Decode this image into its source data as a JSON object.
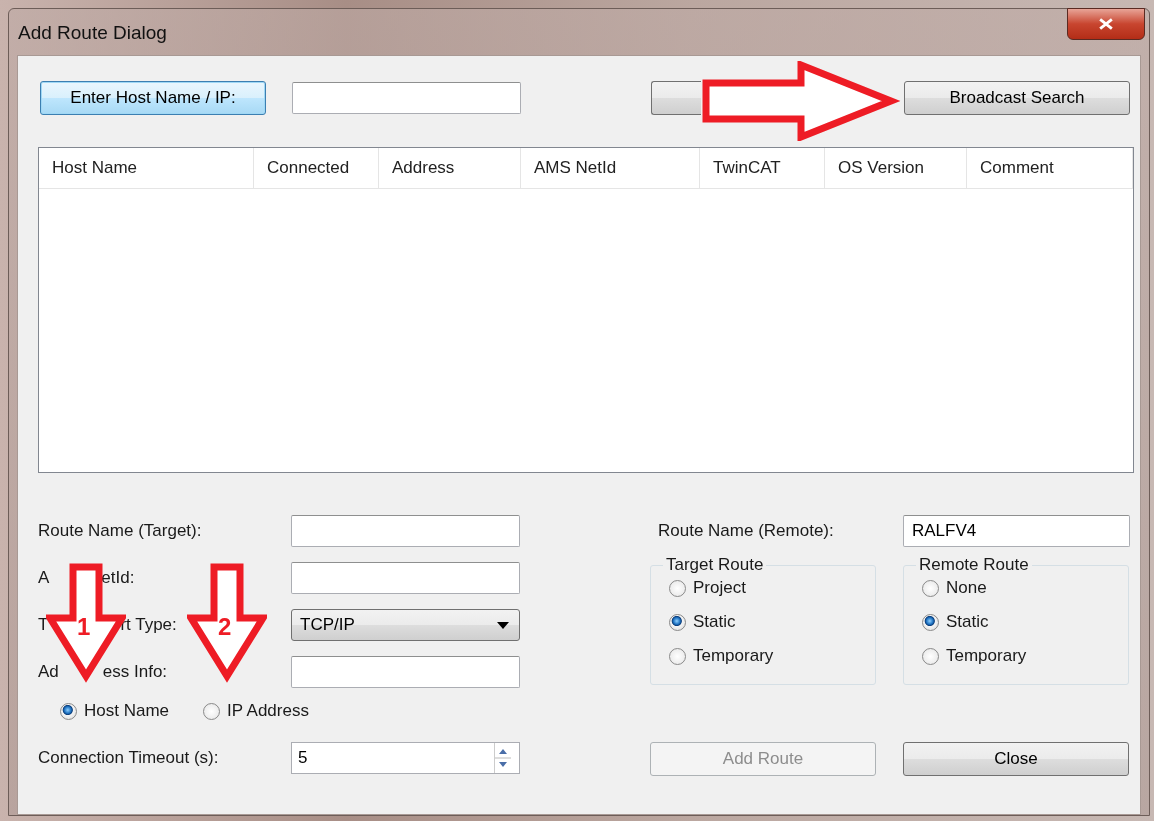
{
  "window": {
    "title": "Add Route Dialog"
  },
  "host_entry": {
    "button": "Enter Host Name / IP:"
  },
  "search_button": {
    "label": "Broadcast Search"
  },
  "hosts_table": {
    "columns": [
      "Host Name",
      "Connected",
      "Address",
      "AMS NetId",
      "TwinCAT",
      "OS Version",
      "Comment"
    ]
  },
  "target_fields": [
    {
      "kind": "text",
      "label_parts": [
        "Route Name (Target):"
      ]
    },
    {
      "kind": "text",
      "label_parts": [
        "A",
        "etId:"
      ]
    },
    {
      "kind": "dropdown",
      "label_parts": [
        "T",
        "rt Type:"
      ],
      "value": "TCP/IP"
    },
    {
      "kind": "text",
      "label_parts": [
        "Ad",
        "ess Info:"
      ]
    }
  ],
  "address_mode": [
    {
      "label": "Host Name",
      "selected": true
    },
    {
      "label": "IP Address",
      "selected": false
    }
  ],
  "timeout": {
    "label": "Connection Timeout (s):",
    "value": "5"
  },
  "remote_name": {
    "label": "Route Name (Remote):",
    "value": "RALFV4"
  },
  "route_groups": [
    {
      "title": "Target Route",
      "options": [
        {
          "label": "Project",
          "selected": false
        },
        {
          "label": "Static",
          "selected": true
        },
        {
          "label": "Temporary",
          "selected": false
        }
      ]
    },
    {
      "title": "Remote Route",
      "options": [
        {
          "label": "None",
          "selected": false
        },
        {
          "label": "Static",
          "selected": true
        },
        {
          "label": "Temporary",
          "selected": false
        }
      ]
    }
  ],
  "actions": [
    {
      "label": "Add Route",
      "disabled": true
    },
    {
      "label": "Close",
      "disabled": false
    }
  ],
  "annotations": [
    {
      "kind": "right-arrow"
    },
    {
      "kind": "down-arrow",
      "label": "1"
    },
    {
      "kind": "down-arrow",
      "label": "2"
    }
  ]
}
